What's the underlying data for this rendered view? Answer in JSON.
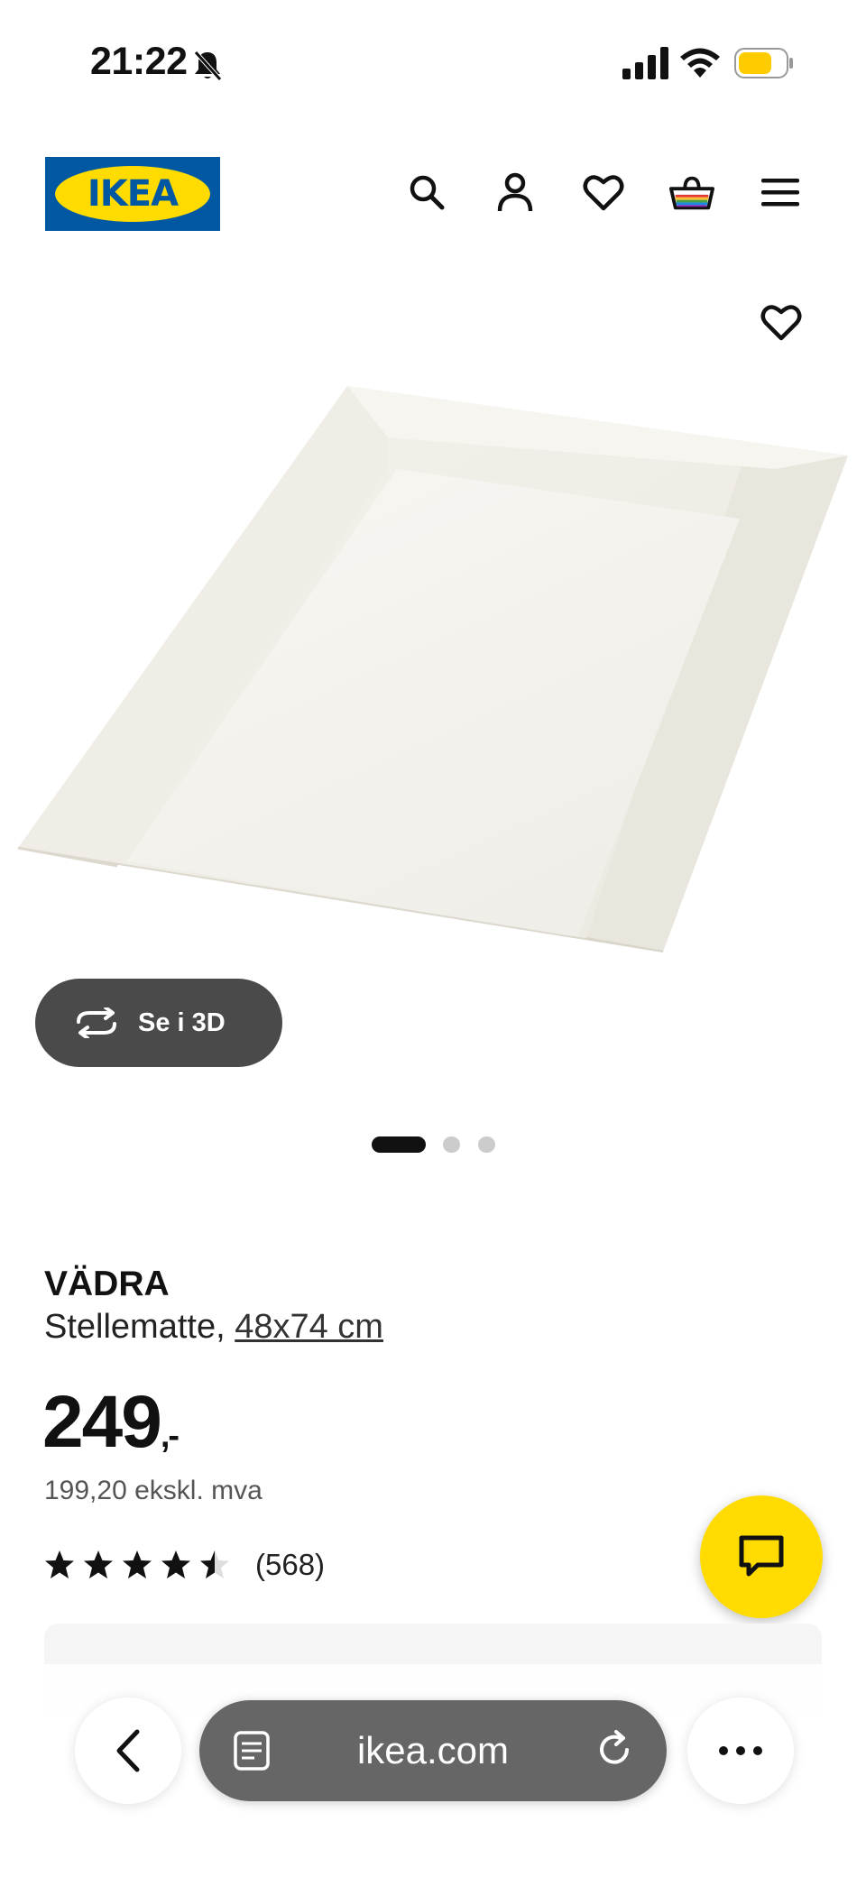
{
  "status_bar": {
    "time": "21:22",
    "icons": [
      "bell-slash-icon",
      "signal-icon",
      "wifi-icon",
      "battery-icon"
    ],
    "battery_color": "#ffcc00"
  },
  "header": {
    "logo_text": "IKEA",
    "icons": [
      "search-icon",
      "account-icon",
      "heart-icon",
      "basket-icon",
      "menu-icon"
    ],
    "brand_blue": "#0058a3",
    "brand_yellow": "#ffdb00"
  },
  "product": {
    "name": "VÄDRA",
    "description": "Stellematte,",
    "size": "48x74 cm",
    "price": "249",
    "price_suffix": ",-",
    "price_ex_vat": "199,20 ekskl. mva",
    "rating_value": 4.5,
    "rating_max": 5,
    "rating_count": "(568)",
    "view_3d_label": "Se i 3D",
    "image_count": 3,
    "active_image": 1
  },
  "browser": {
    "url": "ikea.com",
    "icons": [
      "back-icon",
      "tabs-icon",
      "reload-icon",
      "more-icon"
    ]
  }
}
